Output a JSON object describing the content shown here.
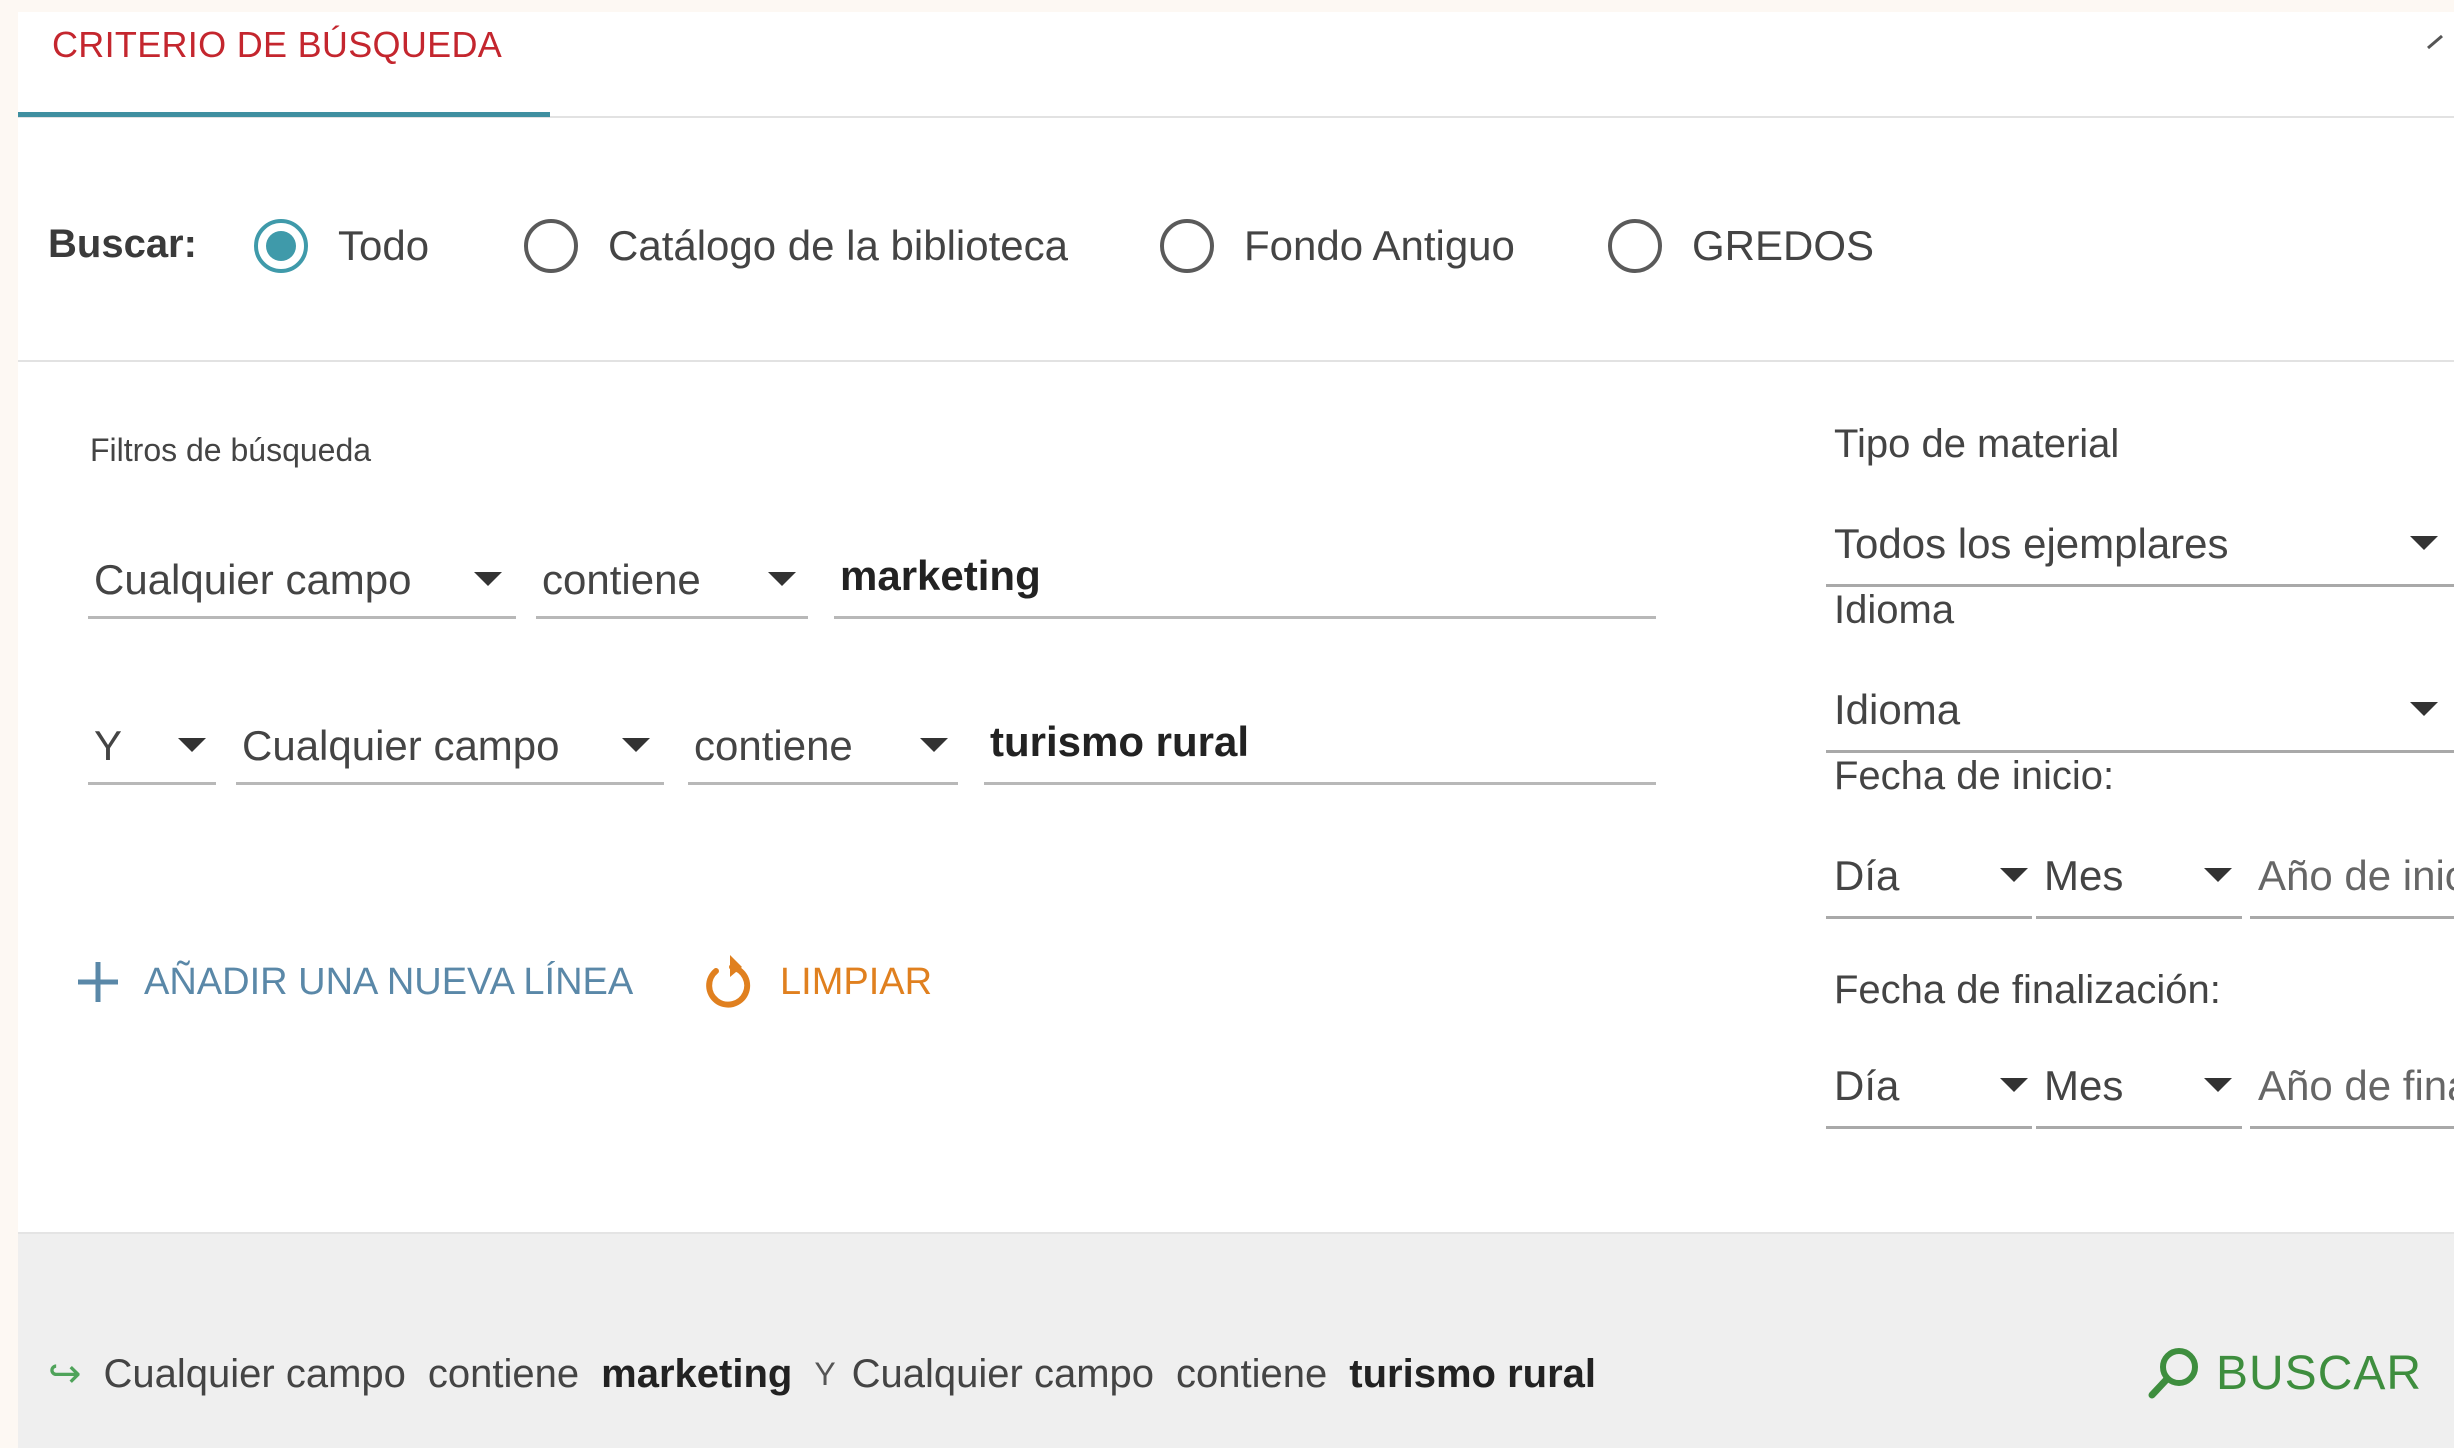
{
  "tabs": {
    "active_label": "CRITERIO DE BÚSQUEDA"
  },
  "scope": {
    "label": "Buscar:",
    "options": [
      {
        "label": "Todo",
        "checked": true
      },
      {
        "label": "Catálogo de la biblioteca",
        "checked": false
      },
      {
        "label": "Fondo Antiguo",
        "checked": false
      },
      {
        "label": "GREDOS",
        "checked": false
      }
    ]
  },
  "filters": {
    "title": "Filtros de búsqueda",
    "line1": {
      "field": "Cualquier campo",
      "operator": "contiene",
      "value": "marketing"
    },
    "line2": {
      "boolean": "Y",
      "field": "Cualquier campo",
      "operator": "contiene",
      "value": "turismo rural"
    },
    "add_line_label": "AÑADIR UNA NUEVA LÍNEA",
    "clear_label": "LIMPIAR"
  },
  "facets": {
    "material_label": "Tipo de material",
    "material_value": "Todos los ejemplares",
    "language_label": "Idioma",
    "language_value": "Idioma",
    "start_label": "Fecha de inicio:",
    "start_day": "Día",
    "start_month": "Mes",
    "start_year_placeholder": "Año de inicio",
    "end_label": "Fecha de finalización:",
    "end_day": "Día",
    "end_month": "Mes",
    "end_year_placeholder": "Año de finalización"
  },
  "footer": {
    "summary": {
      "field1": "Cualquier campo",
      "op1": "contiene",
      "value1": "marketing",
      "boolean": "Y",
      "field2": "Cualquier campo",
      "op2": "contiene",
      "value2": "turismo rural"
    },
    "search_label": "BUSCAR"
  },
  "colors": {
    "tab_text": "#c4262e",
    "tab_underline": "#3f8fa0",
    "radio_checked": "#3f9aaa",
    "add_line": "#5a88a8",
    "clear": "#e0801f",
    "search": "#3e8e3e",
    "footer_bg": "#efefef"
  }
}
